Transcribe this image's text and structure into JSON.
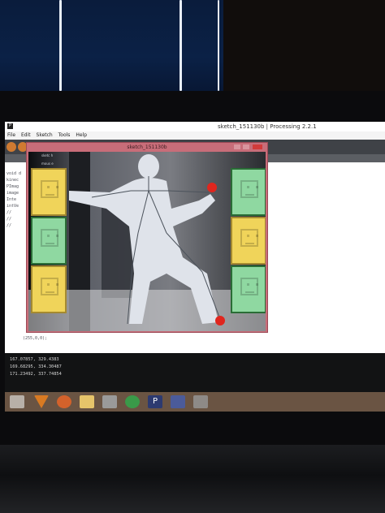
{
  "ide": {
    "title": "sketch_151130b | Processing 2.2.1",
    "menu": [
      "File",
      "Edit",
      "Sketch",
      "Tools",
      "Help"
    ],
    "code_fragments": [
      "void d",
      "kinec",
      "PImag",
      "image",
      "Inte",
      "intVe",
      "//",
      "//",
      "//"
    ],
    "console_lines": [
      "167.07857, 329.4383",
      "169.68295, 334.30487",
      "171.23492, 337.74854"
    ],
    "status_fragment": "(255,0,0);"
  },
  "sketch": {
    "title": "sketch_151130b",
    "label_small_a": "sketc h",
    "label_small_b": "mous e"
  },
  "panels": [
    {
      "side": "left",
      "color": "yellow",
      "state": "active"
    },
    {
      "side": "left",
      "color": "green",
      "state": "idle"
    },
    {
      "side": "left",
      "color": "yellow",
      "state": "active"
    },
    {
      "side": "right",
      "color": "green",
      "state": "idle"
    },
    {
      "side": "right",
      "color": "yellow",
      "state": "active"
    },
    {
      "side": "right",
      "color": "green",
      "state": "idle"
    }
  ],
  "colors": {
    "sketch_frame": "#c86d79",
    "panel_yellow": "#f0d45a",
    "panel_green": "#8fd8a1",
    "hand_marker": "#e0261e",
    "taskbar": "#6a5443"
  },
  "taskbar_icons": [
    "windows-start-icon",
    "vlc-icon",
    "firefox-icon",
    "file-explorer-icon",
    "camera-icon",
    "chrome-icon",
    "processing-icon",
    "photos-icon",
    "window-icon"
  ]
}
